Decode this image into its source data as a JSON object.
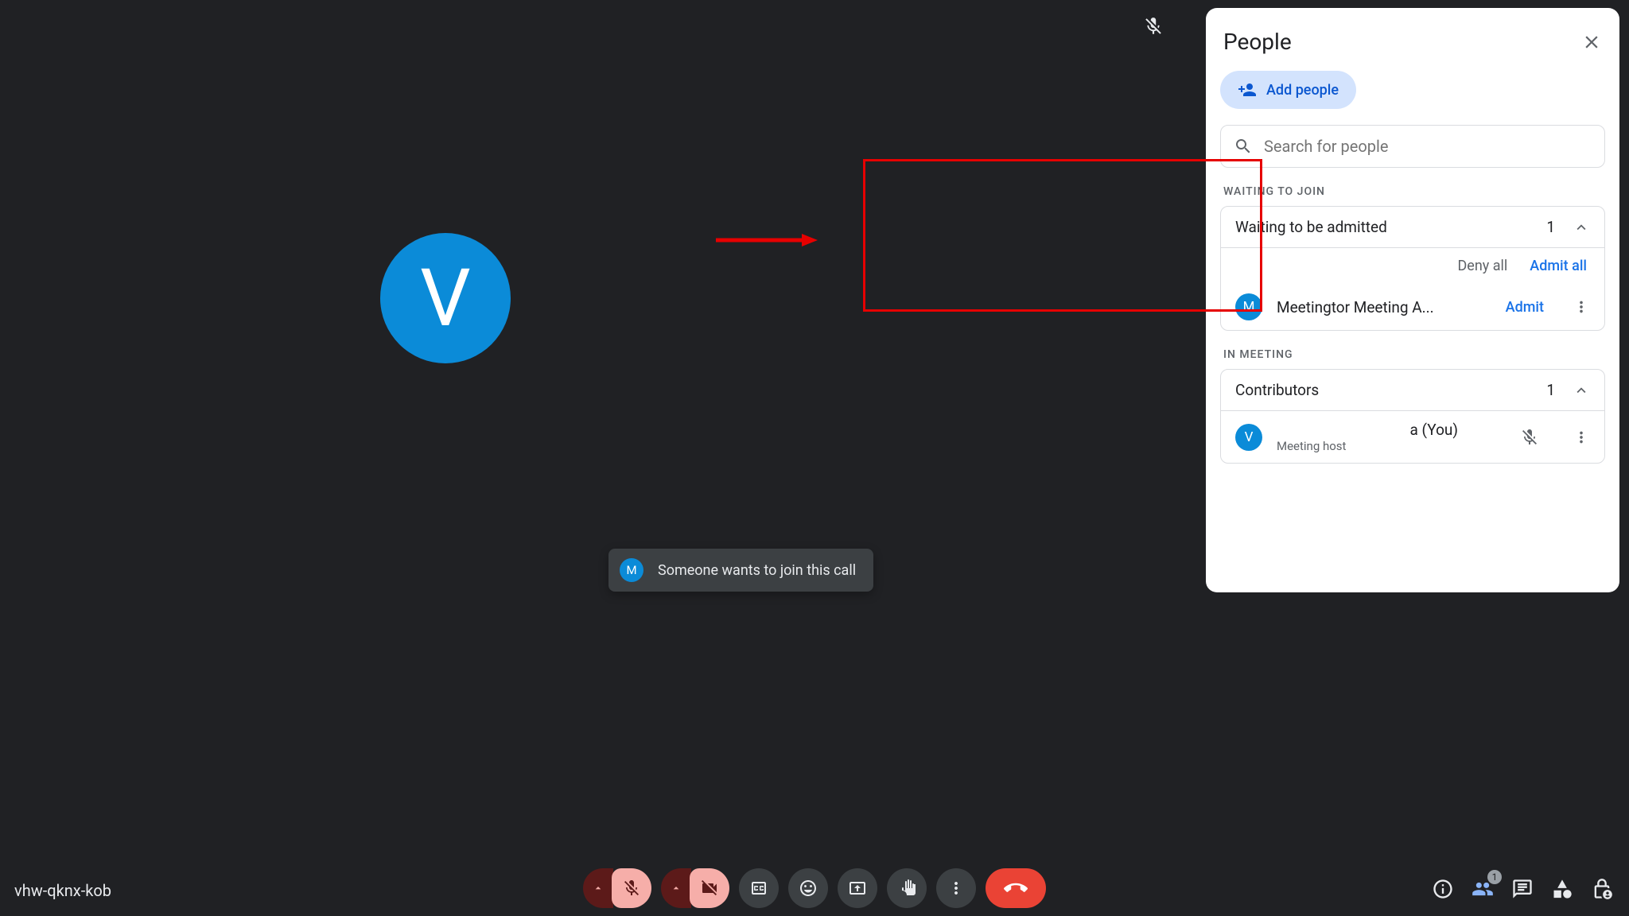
{
  "meeting": {
    "code": "vhw-qknx-kob",
    "main_avatar_initial": "V"
  },
  "toast": {
    "avatar_initial": "M",
    "message": "Someone wants to join this call"
  },
  "panel": {
    "title": "People",
    "add_people_label": "Add people",
    "search_placeholder": "Search for people",
    "waiting": {
      "section_label": "WAITING TO JOIN",
      "header_label": "Waiting to be admitted",
      "count": "1",
      "deny_all_label": "Deny all",
      "admit_all_label": "Admit all",
      "person": {
        "avatar_initial": "M",
        "name": "Meetingtor Meeting A...",
        "admit_label": "Admit"
      }
    },
    "in_meeting": {
      "section_label": "IN MEETING",
      "header_label": "Contributors",
      "count": "1",
      "person": {
        "avatar_initial": "V",
        "name_suffix": "a (You)",
        "role": "Meeting host"
      }
    }
  },
  "right_icons": {
    "people_badge": "1"
  }
}
